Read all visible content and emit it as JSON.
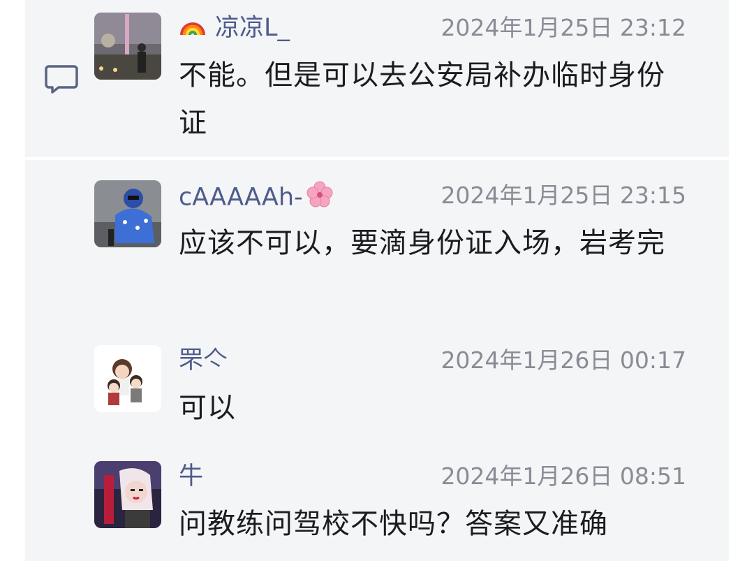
{
  "comments": [
    {
      "username": "凉凉L_",
      "username_prefix_icon": "rainbow-icon",
      "timestamp": "2024年1月25日 23:12",
      "text": "不能。但是可以去公安局补办临时身份证"
    },
    {
      "username": "cAAAAAh-",
      "username_suffix_icon": "cherry-blossom-icon",
      "timestamp": "2024年1月25日 23:15",
      "text": "应该不可以，要滴身份证入场，岩考完"
    },
    {
      "username": "罘亽",
      "timestamp": "2024年1月26日 00:17",
      "text": "可以"
    },
    {
      "username": "牛",
      "timestamp": "2024年1月26日 08:51",
      "text": "问教练问驾校不快吗？答案又准确"
    }
  ],
  "icons": {
    "reply": "comment-bubble-icon"
  },
  "colors": {
    "username": "#4e5b8c",
    "timestamp": "#888c94",
    "text": "#1b1c1f",
    "background": "#f4f5f7"
  }
}
